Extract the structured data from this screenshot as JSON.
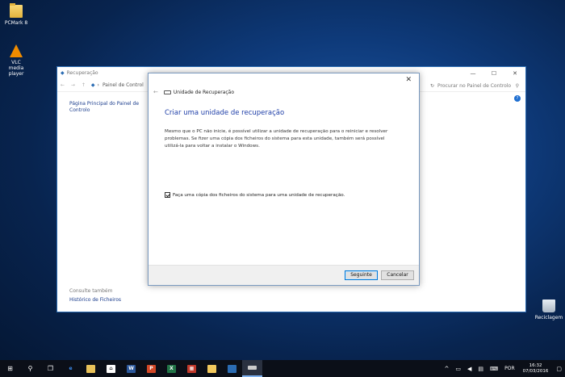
{
  "desktop": {
    "icons": [
      {
        "label": "PCMark 8"
      },
      {
        "label": "VLC media player"
      },
      {
        "label": "Reciclagem"
      }
    ]
  },
  "explorer": {
    "title": "Recuperação",
    "nav_arrows": "← → ↑",
    "breadcrumb": "Painel de Control",
    "search_placeholder": "Procurar no Painel de Controlo",
    "sidebar_link": "Página Principal do Painel de Controlo",
    "see_also": "Consulte também",
    "file_history_link": "Histórico de Ficheiros"
  },
  "dialog": {
    "header": "Unidade de Recuperação",
    "heading": "Criar uma unidade de recuperação",
    "description": "Mesmo que o PC não inicie, é possível utilizar a unidade de recuperação para o reiniciar e resolver problemas. Se fizer uma cópia dos ficheiros do sistema para esta unidade, também será possível utilizá-la para voltar a instalar o Windows.",
    "checkbox_label": "Faça uma cópia dos ficheiros do sistema para uma unidade de recuperação.",
    "checkbox_checked": true,
    "next_label": "Seguinte",
    "cancel_label": "Cancelar"
  },
  "taskbar": {
    "language": "POR",
    "time": "16:32",
    "date": "07/03/2016"
  },
  "colors": {
    "accent": "#0078d7",
    "heading_blue": "#1e3ea8",
    "taskbar": "#0b0f18"
  }
}
